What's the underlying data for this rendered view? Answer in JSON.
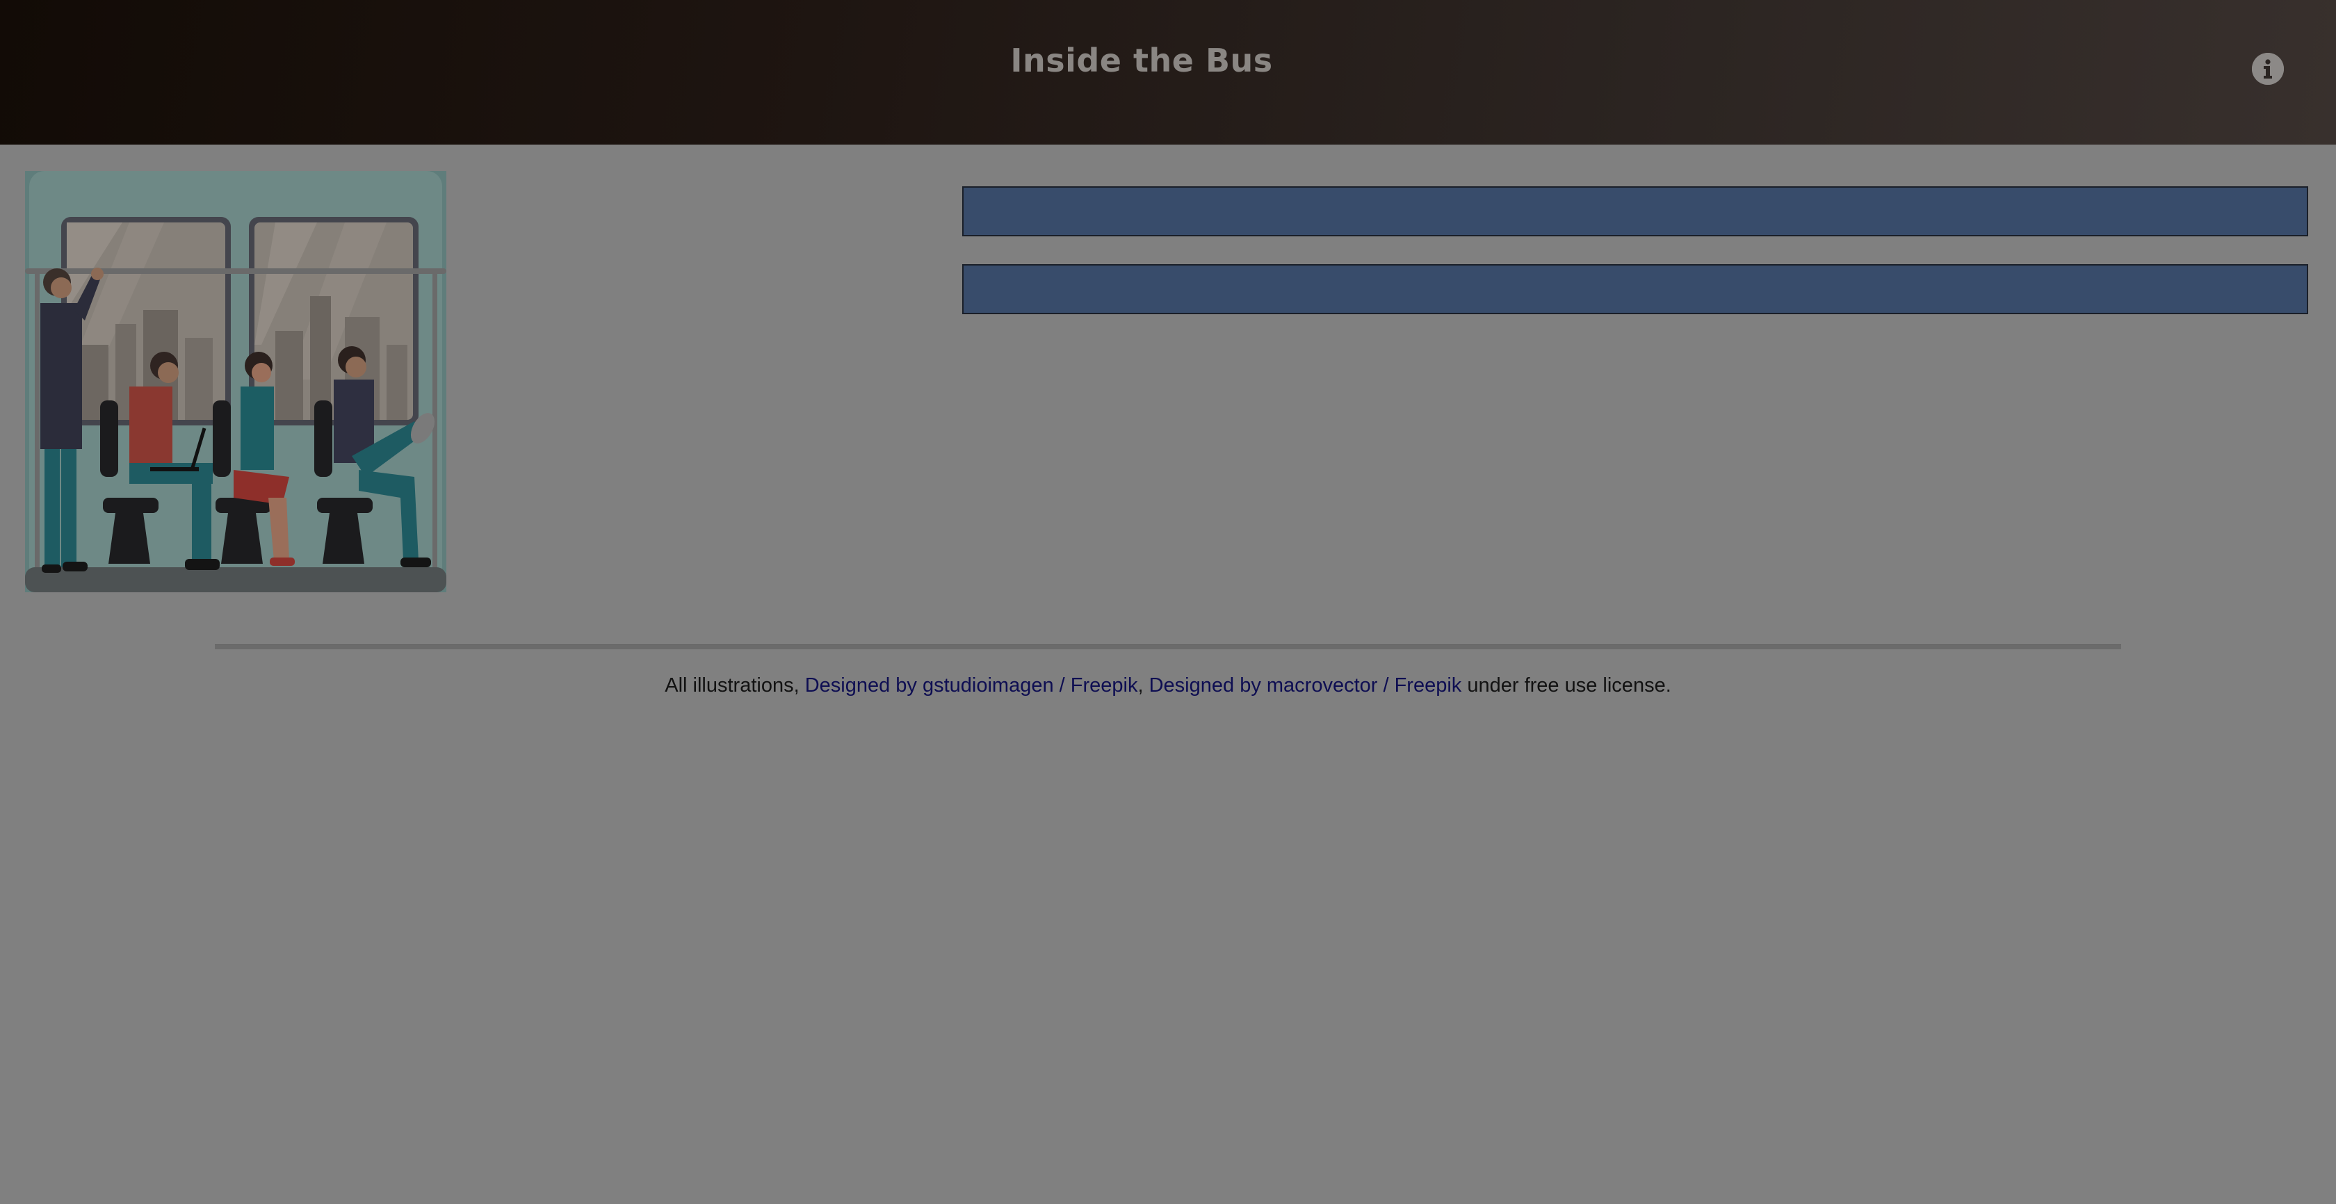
{
  "header": {
    "title": "Inside the Bus",
    "info_icon": "info-icon"
  },
  "main": {
    "illustration_icon": "bus-interior-illustration",
    "bars": [
      "",
      ""
    ]
  },
  "footer": {
    "prefix": "All illustrations, ",
    "link_1": "Designed by gstudioimagen / Freepik",
    "separator": ", ",
    "link_2": "Designed by macrovector / Freepik",
    "suffix": " under free use license."
  },
  "colors": {
    "page_background": "#808080",
    "header_gradient_start": "#120b06",
    "header_gradient_end": "#38302d",
    "bar_fill": "#384c6b",
    "link": "#0e0e52"
  }
}
